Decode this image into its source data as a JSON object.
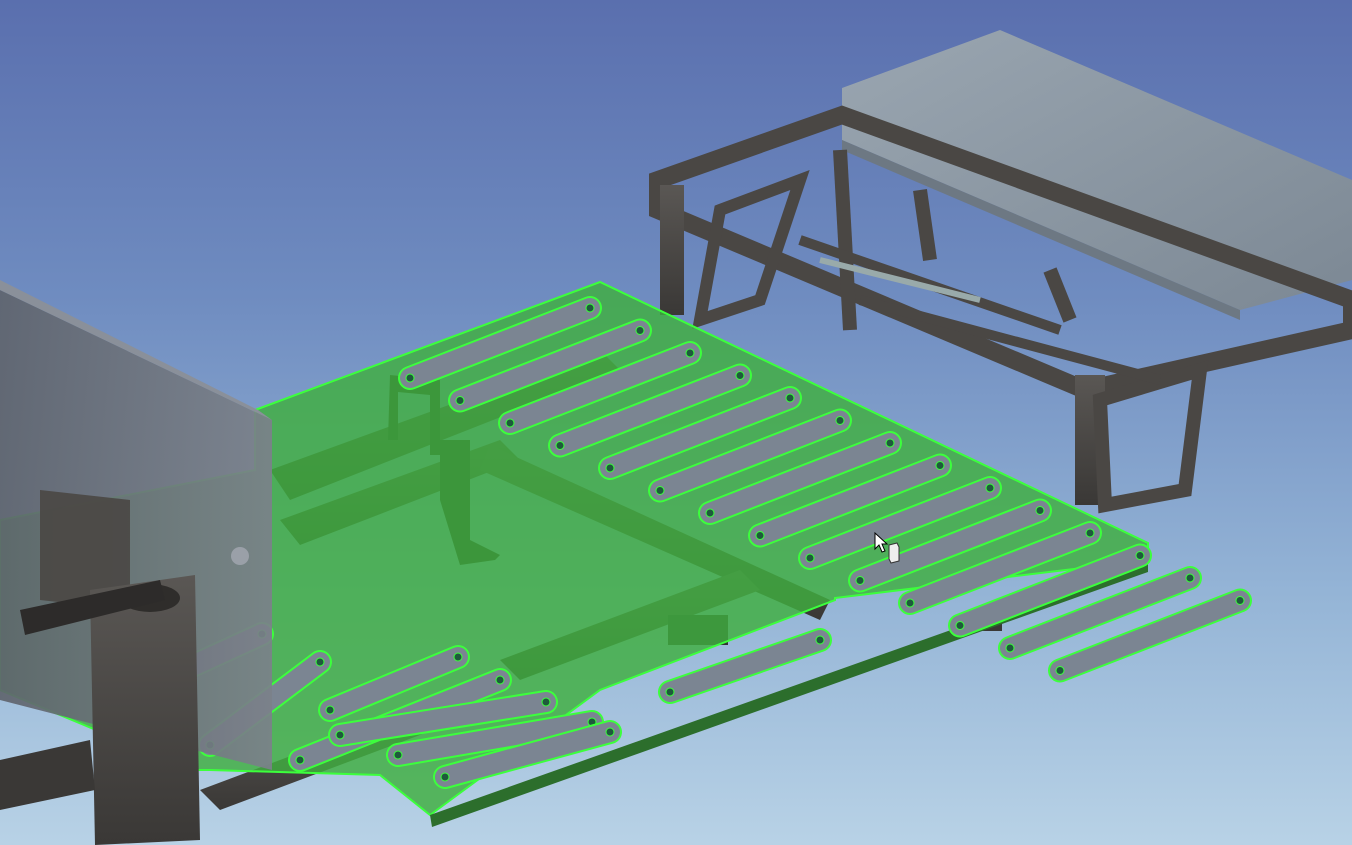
{
  "window": {
    "title": ""
  },
  "viewport": {
    "background_top": "#5a6fae",
    "background_bottom": "#b8d2e6",
    "model": {
      "components": [
        {
          "name": "green-deck-plate",
          "color": "#3fae3f",
          "selected": true,
          "highlight": "#3cff3c"
        },
        {
          "name": "steel-frame",
          "color": "#4a4846"
        },
        {
          "name": "rear-seat-frame",
          "color": "#4f4c49"
        },
        {
          "name": "seat-cushion",
          "color": "#8c98a3"
        },
        {
          "name": "front-housing",
          "color": "#6e737c"
        }
      ],
      "slot_count": 22
    },
    "cursor": {
      "icon": "pointer-with-part-icon"
    }
  }
}
